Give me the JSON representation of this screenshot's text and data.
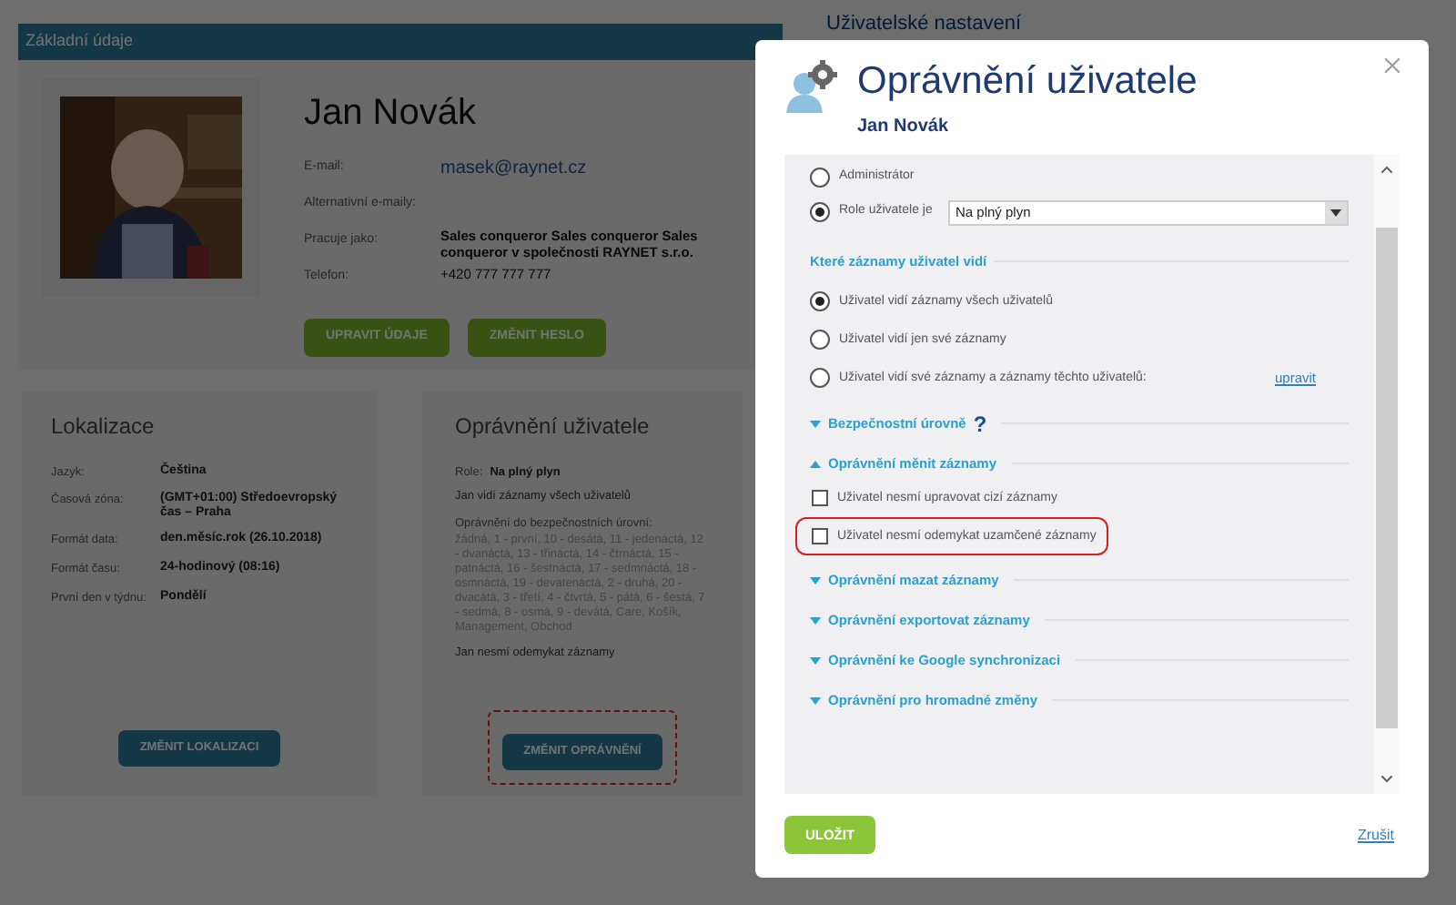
{
  "page": {
    "section_title": "Základní údaje",
    "right_heading": "Uživatelské nastavení",
    "profile": {
      "name": "Jan Novák",
      "fields": [
        {
          "label": "E-mail:",
          "value": "masek@raynet.cz",
          "kind": "email"
        },
        {
          "label": "Alternativní e-maily:"
        },
        {
          "label": "Pracuje jako:",
          "value": "Sales conqueror Sales conqueror Sales conqueror v společnosti RAYNET s.r.o.",
          "kind": "bold"
        },
        {
          "label": "Telefon:",
          "value": "+420 777 777 777",
          "kind": "text"
        }
      ],
      "buttons": [
        "UPRAVIT ÚDAJE",
        "ZMĚNIT HESLO"
      ]
    },
    "localization": {
      "title": "Lokalizace",
      "fields": [
        {
          "label": "Jazyk:",
          "value": "Čeština"
        },
        {
          "label": "Časová zóna:",
          "value": "(GMT+01:00) Středoevropský čas – Praha"
        },
        {
          "label": "Formát data:",
          "value": "den.měsíc.rok (26.10.2018)"
        },
        {
          "label": "Formát času:",
          "value": "24-hodinový (08:16)"
        },
        {
          "label": "První den v týdnu:",
          "value": "Pondělí"
        }
      ],
      "button": "ZMĚNIT LOKALIZACI"
    },
    "permissions": {
      "title": "Oprávnění uživatele",
      "role_label": "Role:",
      "role_value": "Na plný plyn",
      "visibility": "Jan vidí záznamy všech uživatelů",
      "levels_label": "Oprávnění do bezpečnostních úrovní:",
      "levels": "žádná, 1 - první, 10 - desátá, 11 - jedenáctá, 12 - dvanáctá, 13 - třináctá, 14 - čtrnáctá, 15 - patnáctá, 16 - šestnáctá, 17 - sedmnáctá, 18 - osmnáctá, 19 - devatenáctá, 2 - druhá, 20 - dvacátá, 3 - třetí, 4 - čtvrtá, 5 - pátá, 6 - šestá, 7 - sedmá, 8 - osmá, 9 - devátá, Care, Košík, Management, Obchod",
      "unlock": "Jan nesmí odemykat záznamy",
      "button": "ZMĚNIT OPRÁVNĚNÍ",
      "button_highlighted": true
    }
  },
  "modal": {
    "title": "Oprávnění uživatele",
    "subtitle": "Jan Novák",
    "roles": [
      {
        "label": "Administrátor",
        "selected": false
      },
      {
        "label": "Role uživatele je",
        "selected": true,
        "select_value": "Na plný plyn"
      }
    ],
    "visibility": {
      "title": "Které záznamy uživatel vidí",
      "options": [
        {
          "label": "Uživatel vidí záznamy všech uživatelů",
          "selected": true
        },
        {
          "label": "Uživatel vidí jen své záznamy",
          "selected": false
        },
        {
          "label": "Uživatel vidí své záznamy a záznamy těchto uživatelů:",
          "selected": false,
          "link": "upravit"
        }
      ]
    },
    "sections": [
      {
        "title": "Bezpečnostní úrovně",
        "expanded": false,
        "help": "?"
      },
      {
        "title": "Oprávnění měnit záznamy",
        "expanded": true,
        "items": [
          {
            "label": "Uživatel nesmí upravovat cizí záznamy",
            "checked": false,
            "highlighted": false
          },
          {
            "label": "Uživatel nesmí odemykat uzamčené záznamy",
            "checked": false,
            "highlighted": true
          }
        ]
      },
      {
        "title": "Oprávnění mazat záznamy",
        "expanded": false
      },
      {
        "title": "Oprávnění exportovat záznamy",
        "expanded": false
      },
      {
        "title": "Oprávnění ke Google synchronizaci",
        "expanded": false
      },
      {
        "title": "Oprávnění pro hromadné změny",
        "expanded": false
      }
    ],
    "save": "ULOŽIT",
    "cancel": "Zrušit"
  }
}
